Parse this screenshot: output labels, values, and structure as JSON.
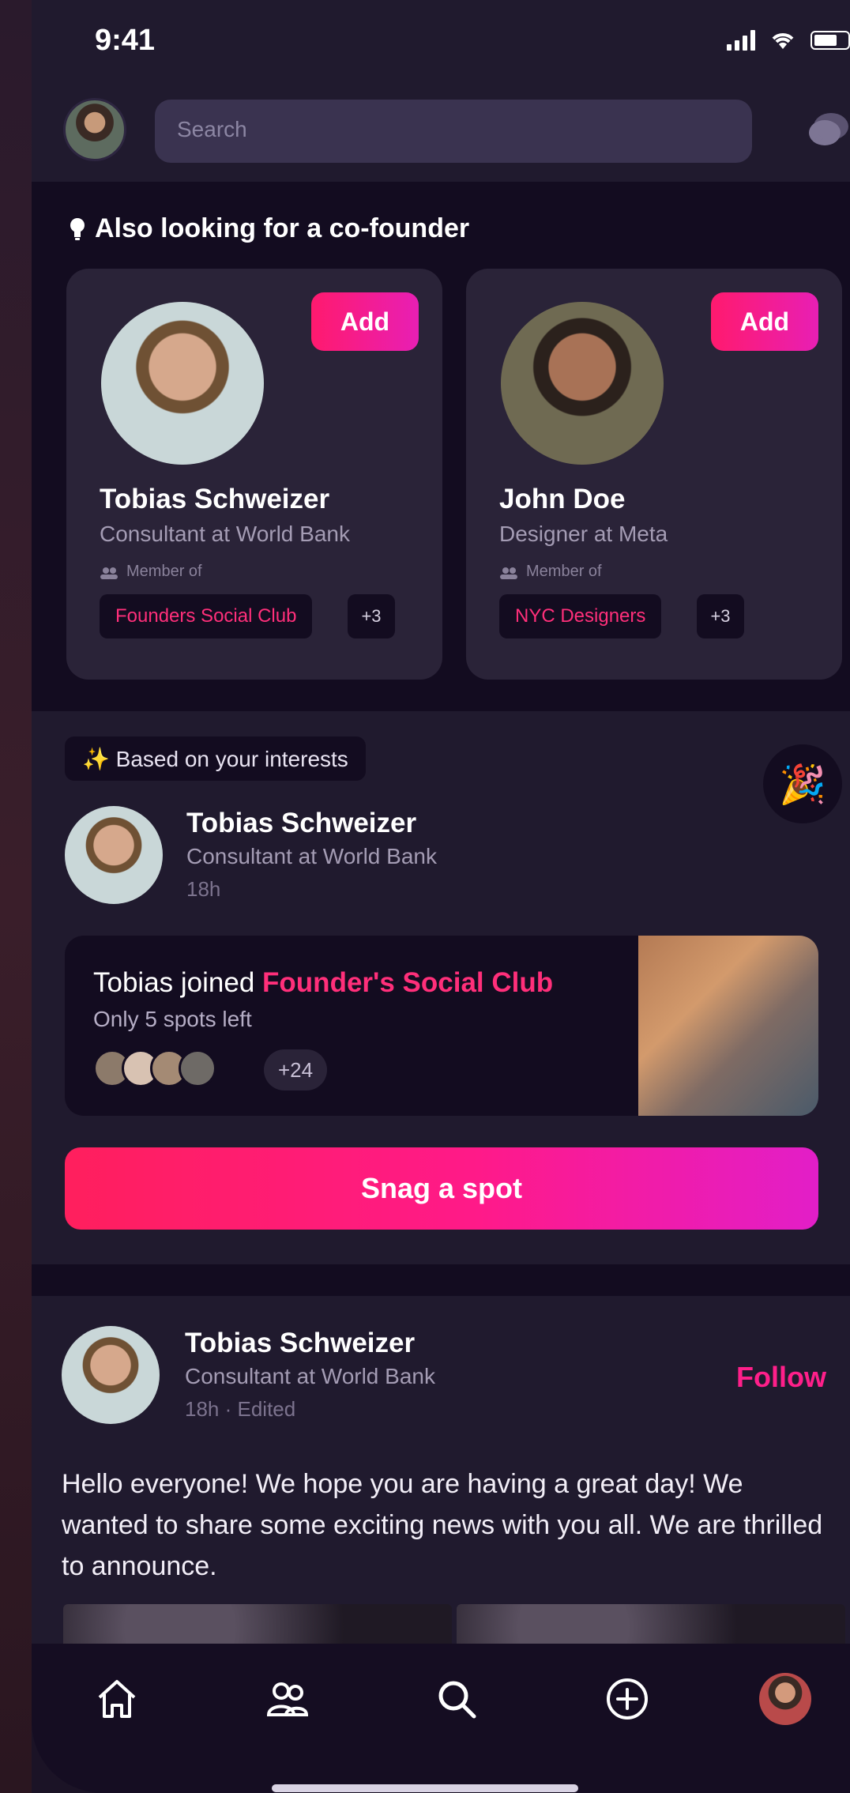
{
  "status_bar": {
    "time": "9:41"
  },
  "header": {
    "search_placeholder": "Search",
    "avatar_icon": "profile-avatar",
    "chat_icon": "chat-bubble-icon"
  },
  "cofounder": {
    "title": "Also looking for a co-founder",
    "title_icon": "lightbulb-icon",
    "cards": [
      {
        "name": "Tobias Schweizer",
        "role": "Consultant at World Bank",
        "member_label": "Member of",
        "club": "Founders Social Club",
        "more": "+3",
        "add_label": "Add"
      },
      {
        "name": "John Doe",
        "role": "Designer at Meta",
        "member_label": "Member of",
        "club": "NYC Designers",
        "more": "+3",
        "add_label": "Add"
      }
    ]
  },
  "interests": {
    "pill": "✨ Based on your interests",
    "party_icon": "🎉",
    "author": {
      "name": "Tobias Schweizer",
      "role": "Consultant at World Bank",
      "time": "18h"
    },
    "join_card": {
      "prefix": "Tobias joined ",
      "club": "Founder's Social Club",
      "spots": "Only 5 spots left",
      "more_count": "+24"
    },
    "cta": "Snag a spot"
  },
  "post": {
    "author": {
      "name": "Tobias Schweizer",
      "role": "Consultant at World Bank",
      "time": "18h · Edited"
    },
    "follow_label": "Follow",
    "text": "Hello everyone! We hope you are having a great day! We wanted to share some exciting news with you all. We are thrilled to announce."
  },
  "tabbar": {
    "items": [
      "home-icon",
      "people-icon",
      "search-icon",
      "add-circle-icon",
      "profile-avatar"
    ]
  },
  "colors": {
    "accent": "#ff1f8a",
    "accent_gradient_start": "#ff1f5d",
    "accent_gradient_end": "#e21ec8",
    "background": "#201a2e",
    "surface_dark": "#130c20",
    "card": "#2a2338"
  }
}
